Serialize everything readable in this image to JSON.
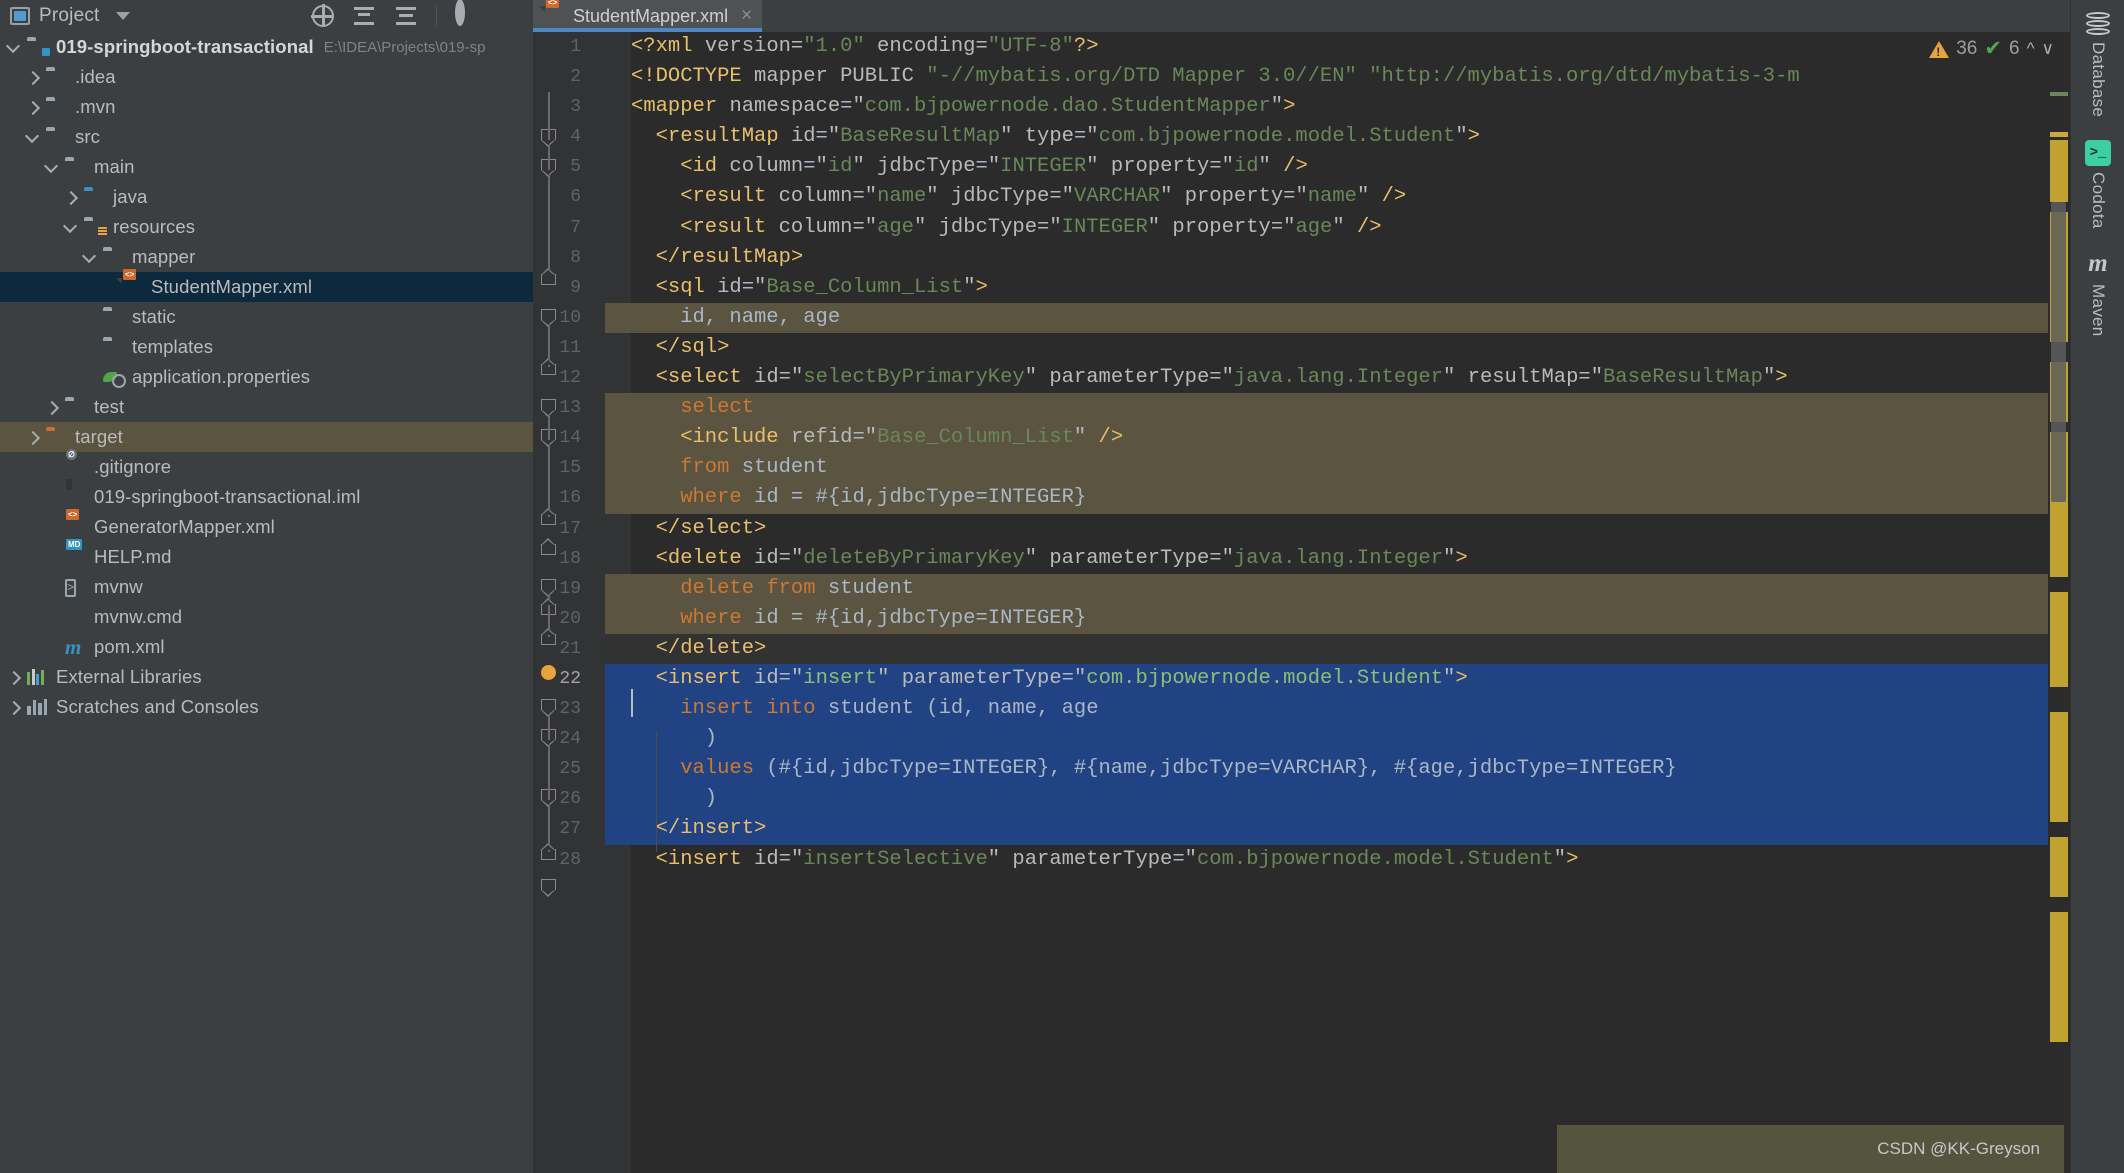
{
  "project_panel": {
    "title": "Project",
    "toolbar_icons": [
      "locate-icon",
      "collapse-all-icon",
      "expand-all-icon",
      "settings-icon",
      "hide-icon"
    ],
    "root": {
      "label": "019-springboot-transactional",
      "path": "E:\\IDEA\\Projects\\019-sp"
    },
    "items": [
      {
        "label": ".idea",
        "icon": "folder-icon",
        "indent": 2,
        "arrow": "right",
        "state": "normal"
      },
      {
        "label": ".mvn",
        "icon": "folder-icon",
        "indent": 2,
        "arrow": "right",
        "state": "normal"
      },
      {
        "label": "src",
        "icon": "folder-icon",
        "indent": 2,
        "arrow": "down",
        "state": "normal"
      },
      {
        "label": "main",
        "icon": "folder-icon",
        "indent": 3,
        "arrow": "down",
        "state": "normal"
      },
      {
        "label": "java",
        "icon": "source-folder-icon",
        "indent": 4,
        "arrow": "right",
        "state": "normal"
      },
      {
        "label": "resources",
        "icon": "resource-folder-icon",
        "indent": 4,
        "arrow": "down",
        "state": "normal"
      },
      {
        "label": "mapper",
        "icon": "folder-icon",
        "indent": 5,
        "arrow": "down",
        "state": "normal"
      },
      {
        "label": "StudentMapper.xml",
        "icon": "xml-file-icon",
        "indent": 6,
        "arrow": "none",
        "state": "selected"
      },
      {
        "label": "static",
        "icon": "folder-icon",
        "indent": 5,
        "arrow": "none",
        "state": "normal"
      },
      {
        "label": "templates",
        "icon": "folder-icon",
        "indent": 5,
        "arrow": "none",
        "state": "normal"
      },
      {
        "label": "application.properties",
        "icon": "spring-properties-icon",
        "indent": 5,
        "arrow": "none",
        "state": "normal"
      },
      {
        "label": "test",
        "icon": "folder-icon",
        "indent": 3,
        "arrow": "right",
        "state": "normal"
      },
      {
        "label": "target",
        "icon": "excluded-folder-icon",
        "indent": 2,
        "arrow": "right",
        "state": "highlighted"
      },
      {
        "label": ".gitignore",
        "icon": "gitignore-file-icon",
        "indent": 3,
        "arrow": "none",
        "state": "normal"
      },
      {
        "label": "019-springboot-transactional.iml",
        "icon": "iml-file-icon",
        "indent": 3,
        "arrow": "none",
        "state": "normal"
      },
      {
        "label": "GeneratorMapper.xml",
        "icon": "xml-file-icon",
        "indent": 3,
        "arrow": "none",
        "state": "normal"
      },
      {
        "label": "HELP.md",
        "icon": "markdown-file-icon",
        "indent": 3,
        "arrow": "none",
        "state": "normal"
      },
      {
        "label": "mvnw",
        "icon": "shell-script-icon",
        "indent": 3,
        "arrow": "none",
        "state": "normal"
      },
      {
        "label": "mvnw.cmd",
        "icon": "cmd-script-icon",
        "indent": 3,
        "arrow": "none",
        "state": "normal"
      },
      {
        "label": "pom.xml",
        "icon": "maven-pom-icon",
        "indent": 3,
        "arrow": "none",
        "state": "normal"
      },
      {
        "label": "External Libraries",
        "icon": "libraries-icon",
        "indent": 1,
        "arrow": "right",
        "state": "normal"
      },
      {
        "label": "Scratches and Consoles",
        "icon": "scratches-icon",
        "indent": 1,
        "arrow": "right",
        "state": "normal"
      }
    ]
  },
  "editor": {
    "tabs": [
      {
        "label": "StudentMapper.xml",
        "icon": "xml-file-icon",
        "close": "×",
        "active": true
      }
    ],
    "more_actions": "⋮",
    "inspection": {
      "warning_icon": "warning-triangle-icon",
      "warning_count": "36",
      "check_icon": "inspection-check-icon",
      "check_count": "6",
      "prev_icon": "chevron-up-icon",
      "next_icon": "chevron-down-icon"
    },
    "current_line": 22,
    "lines": [
      {
        "n": 1,
        "bg": "none"
      },
      {
        "n": 2,
        "bg": "none"
      },
      {
        "n": 3,
        "bg": "none"
      },
      {
        "n": 4,
        "bg": "none"
      },
      {
        "n": 5,
        "bg": "none"
      },
      {
        "n": 6,
        "bg": "none"
      },
      {
        "n": 7,
        "bg": "none"
      },
      {
        "n": 8,
        "bg": "none"
      },
      {
        "n": 9,
        "bg": "none"
      },
      {
        "n": 10,
        "bg": "sql"
      },
      {
        "n": 11,
        "bg": "none"
      },
      {
        "n": 12,
        "bg": "none"
      },
      {
        "n": 13,
        "bg": "sql"
      },
      {
        "n": 14,
        "bg": "sql"
      },
      {
        "n": 15,
        "bg": "sql"
      },
      {
        "n": 16,
        "bg": "sql"
      },
      {
        "n": 17,
        "bg": "none"
      },
      {
        "n": 18,
        "bg": "none"
      },
      {
        "n": 19,
        "bg": "sql"
      },
      {
        "n": 20,
        "bg": "sql"
      },
      {
        "n": 21,
        "bg": "cur"
      },
      {
        "n": 22,
        "bg": "sel"
      },
      {
        "n": 23,
        "bg": "sel"
      },
      {
        "n": 24,
        "bg": "sel"
      },
      {
        "n": 25,
        "bg": "sel"
      },
      {
        "n": 26,
        "bg": "sel"
      },
      {
        "n": 27,
        "bg": "sel"
      },
      {
        "n": 28,
        "bg": "none"
      }
    ],
    "code_text": {
      "l1": "<?xml version=\"1.0\" encoding=\"UTF-8\"?>",
      "l2": "<!DOCTYPE mapper PUBLIC \"-//mybatis.org/DTD Mapper 3.0//EN\" \"http://mybatis.org/dtd/mybatis-3-m",
      "l3": "<mapper namespace=\"com.bjpowernode.dao.StudentMapper\">",
      "l4": "<resultMap id=\"BaseResultMap\" type=\"com.bjpowernode.model.Student\">",
      "l5": "<id column=\"id\" jdbcType=\"INTEGER\" property=\"id\" />",
      "l6": "<result column=\"name\" jdbcType=\"VARCHAR\" property=\"name\" />",
      "l7": "<result column=\"age\" jdbcType=\"INTEGER\" property=\"age\" />",
      "l8": "</resultMap>",
      "l9": "<sql id=\"Base_Column_List\">",
      "l10": "id, name, age",
      "l11": "</sql>",
      "l12": "<select id=\"selectByPrimaryKey\" parameterType=\"java.lang.Integer\" resultMap=\"BaseResultMap\">",
      "l13": "select",
      "l14": "<include refid=\"Base_Column_List\" />",
      "l15": "from student",
      "l16": "where id = #{id,jdbcType=INTEGER}",
      "l17": "</select>",
      "l18": "<delete id=\"deleteByPrimaryKey\" parameterType=\"java.lang.Integer\">",
      "l19": "delete from student",
      "l20": "where id = #{id,jdbcType=INTEGER}",
      "l21": "</delete>",
      "l22": "<insert id=\"insert\" parameterType=\"com.bjpowernode.model.Student\">",
      "l23": "insert into student (id, name, age",
      "l24": ")",
      "l25": "values (#{id,jdbcType=INTEGER}, #{name,jdbcType=VARCHAR}, #{age,jdbcType=INTEGER}",
      "l26": ")",
      "l27": "</insert>",
      "l28": "<insert id=\"insertSelective\" parameterType=\"com.bjpowernode.model.Student\">"
    }
  },
  "right_sidebar": {
    "items": [
      {
        "label": "Database",
        "icon": "database-icon"
      },
      {
        "label": "Codota",
        "icon": "codota-icon"
      },
      {
        "label": "Maven",
        "icon": "maven-icon"
      }
    ]
  },
  "watermark": {
    "text": "CSDN @KK-Greyson"
  },
  "colors": {
    "accent_blue": "#4A88C7",
    "selection_blue": "#214283",
    "sql_injection": "#5A5440",
    "tag": "#E8BF6A",
    "value": "#6A8759",
    "keyword": "#CC7832",
    "text": "#A9B7C6",
    "warning": "#E8A33D",
    "ok_green": "#4EA94E"
  }
}
